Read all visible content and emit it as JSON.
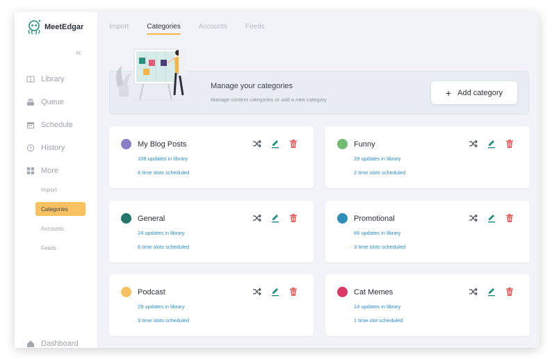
{
  "app": {
    "name": "MeetEdgar"
  },
  "sidebar": {
    "collapse_glyph": "«",
    "items": [
      {
        "label": "Library",
        "icon": "book-icon"
      },
      {
        "label": "Queue",
        "icon": "queue-icon"
      },
      {
        "label": "Schedule",
        "icon": "calendar-icon"
      },
      {
        "label": "History",
        "icon": "history-icon"
      },
      {
        "label": "More",
        "icon": "grid-icon"
      }
    ],
    "sub_items": [
      "Import",
      "Categories",
      "Accounts",
      "Feeds"
    ],
    "active_sub": "Categories",
    "footer": {
      "label": "Dashboard",
      "icon": "home-icon"
    }
  },
  "tabs": [
    {
      "label": "Import",
      "active": false
    },
    {
      "label": "Categories",
      "active": true
    },
    {
      "label": "Accounts",
      "active": false
    },
    {
      "label": "Feeds",
      "active": false
    }
  ],
  "banner": {
    "title": "Manage your categories",
    "subtitle": "Manage content categories or add a new category",
    "button_label": "Add category"
  },
  "categories": [
    {
      "name": "My Blog Posts",
      "color": "#8a7ec6",
      "updates": "108 updates in library",
      "slots": "6 time slots scheduled"
    },
    {
      "name": "Funny",
      "color": "#72bb73",
      "updates": "29 updates in library",
      "slots": "2 time slots scheduled"
    },
    {
      "name": "General",
      "color": "#24766b",
      "updates": "24 updates in library",
      "slots": "6 time slots scheduled"
    },
    {
      "name": "Promotional",
      "color": "#2e8dbb",
      "updates": "66 updates in library",
      "slots": "3 time slots scheduled"
    },
    {
      "name": "Podcast",
      "color": "#f7c063",
      "updates": "29 updates in library",
      "slots": "3 time slots scheduled"
    },
    {
      "name": "Cat Memes",
      "color": "#db3a67",
      "updates": "14 updates in library",
      "slots": "1 time slot scheduled"
    }
  ],
  "colors": {
    "accent": "#f8c262",
    "link": "#2d8cd1",
    "edit": "#1f8e7f",
    "delete": "#e25a5a"
  }
}
